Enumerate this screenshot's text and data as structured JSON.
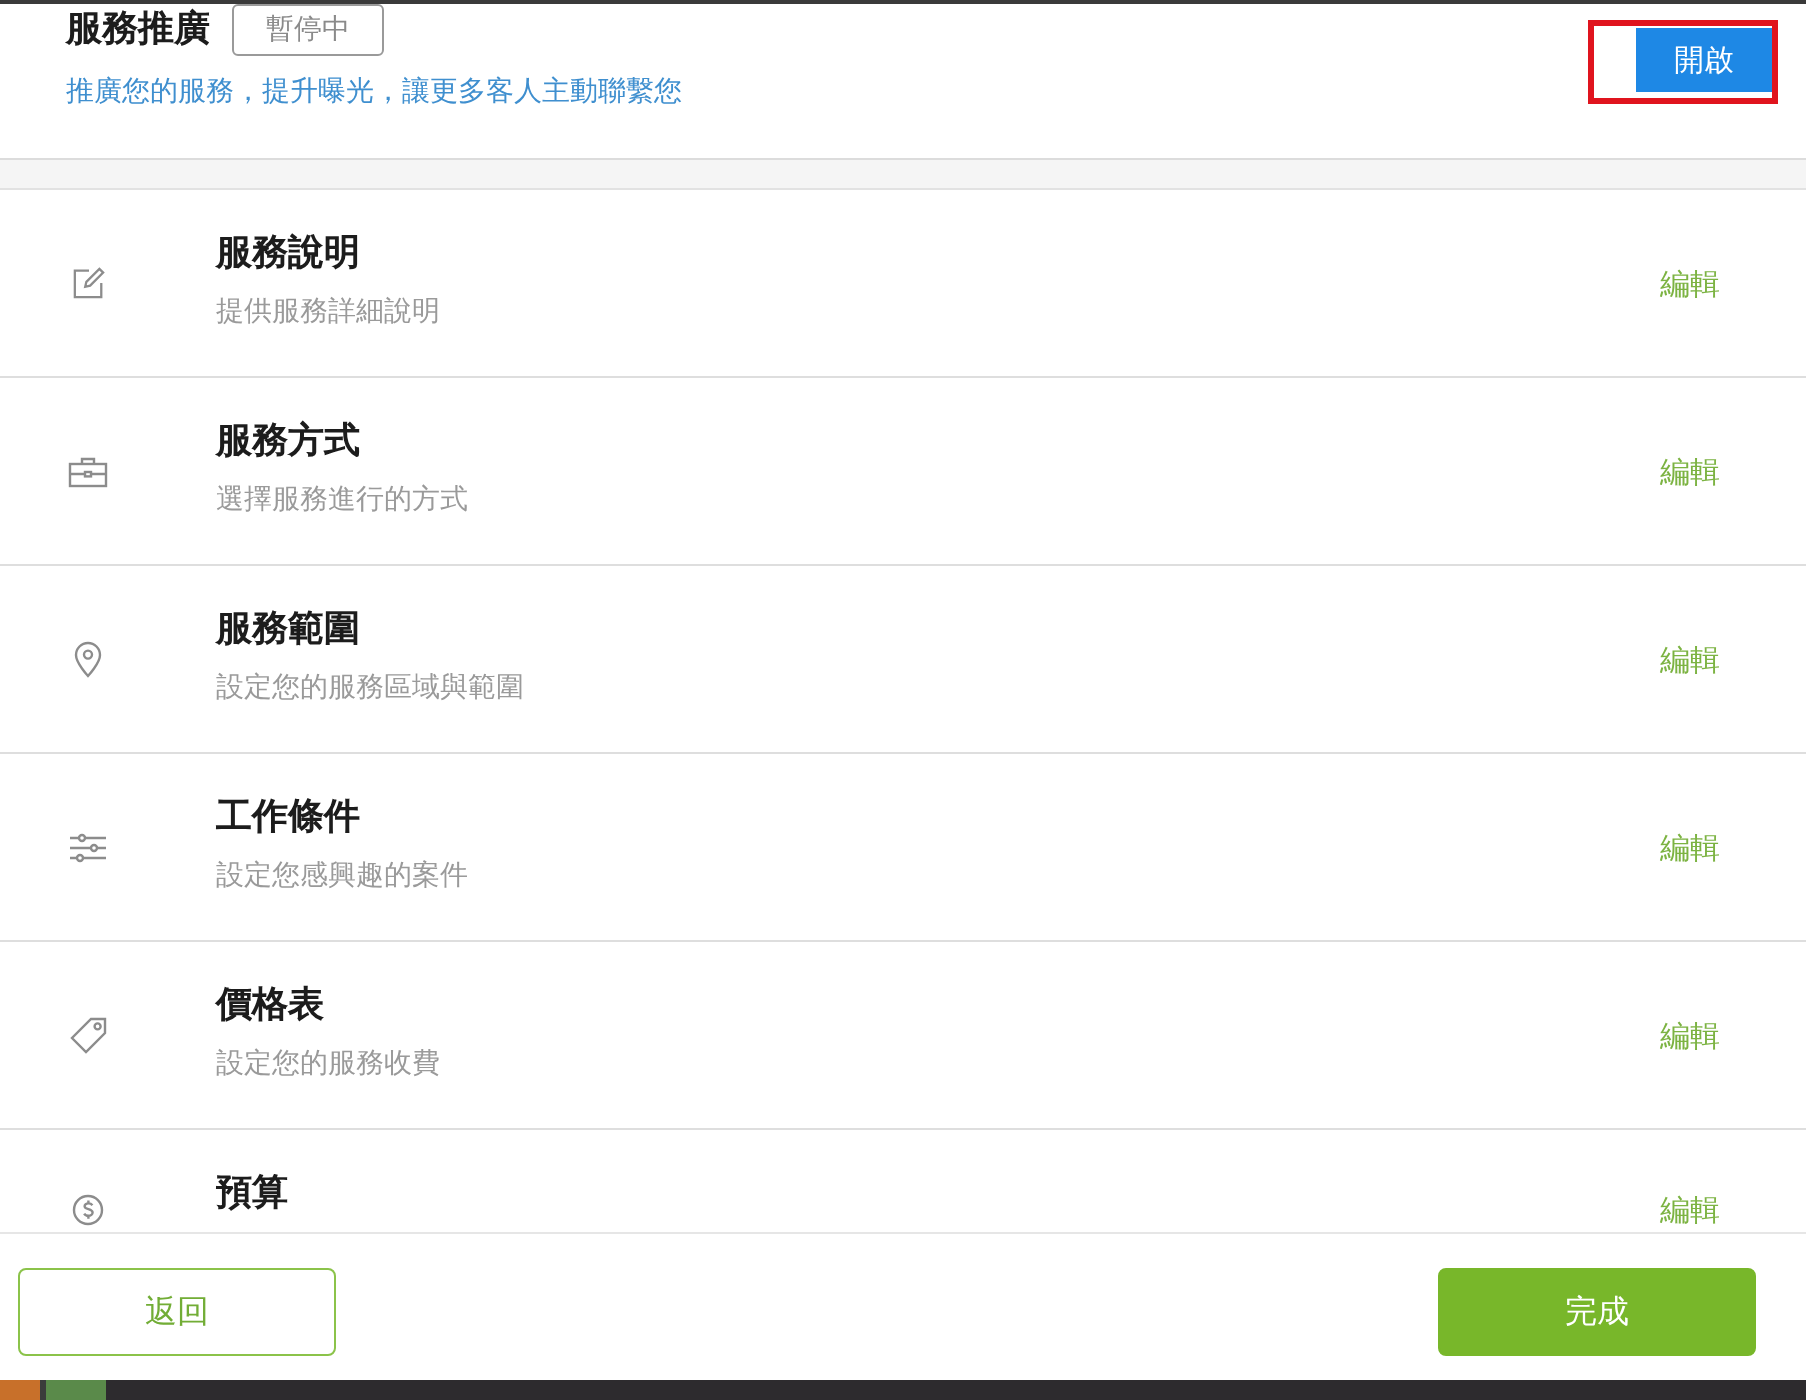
{
  "header": {
    "title": "服務推廣",
    "status_badge": "暫停中",
    "subtitle": "推廣您的服務，提升曝光，讓更多客人主動聯繫您",
    "action": {
      "label": "開啟",
      "highlighted": true
    }
  },
  "rows": [
    {
      "title": "服務說明",
      "subtitle": "提供服務詳細說明",
      "action": "編輯"
    },
    {
      "title": "服務方式",
      "subtitle": "選擇服務進行的方式",
      "action": "編輯"
    },
    {
      "title": "服務範圍",
      "subtitle": "設定您的服務區域與範圍",
      "action": "編輯"
    },
    {
      "title": "工作條件",
      "subtitle": "設定您感興趣的案件",
      "action": "編輯"
    },
    {
      "title": "價格表",
      "subtitle": "設定您的服務收費",
      "action": "編輯"
    },
    {
      "title": "預算",
      "action": "編輯"
    }
  ],
  "footer": {
    "back_button": "返回",
    "done_button": "完成"
  }
}
